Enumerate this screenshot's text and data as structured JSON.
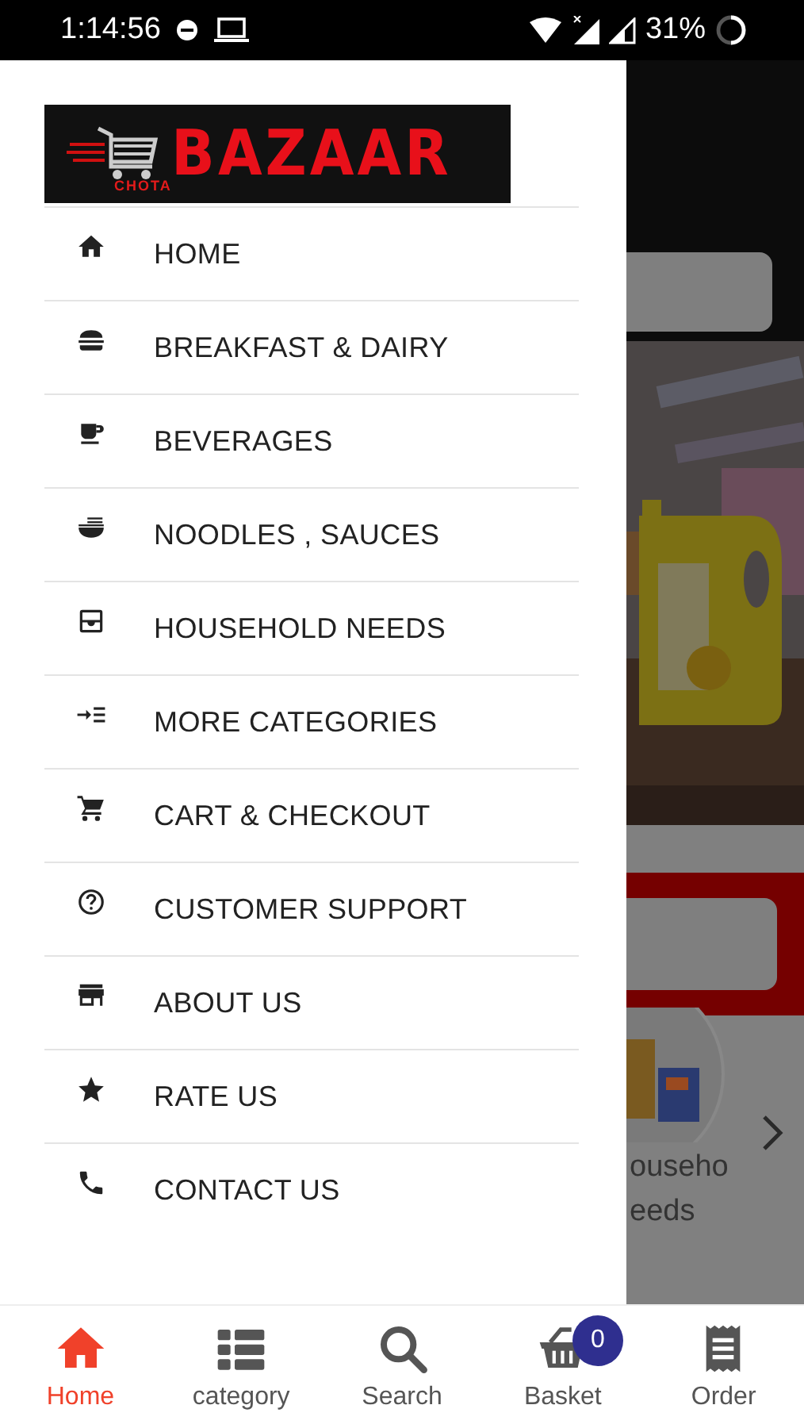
{
  "status_bar": {
    "time": "1:14:56",
    "battery": "31%"
  },
  "drawer": {
    "logo": {
      "small": "CHOTA",
      "big": "BAZAAR"
    },
    "items": [
      {
        "kind": "home",
        "label": "HOME"
      },
      {
        "kind": "burger",
        "label": "BREAKFAST & DAIRY"
      },
      {
        "kind": "cup",
        "label": "BEVERAGES"
      },
      {
        "kind": "bowl",
        "label": "NOODLES , SAUCES"
      },
      {
        "kind": "inbox",
        "label": "HOUSEHOLD NEEDS"
      },
      {
        "kind": "more",
        "label": "MORE CATEGORIES"
      },
      {
        "kind": "cart",
        "label": "CART & CHECKOUT"
      },
      {
        "kind": "help",
        "label": "CUSTOMER SUPPORT"
      },
      {
        "kind": "store",
        "label": "ABOUT US"
      },
      {
        "kind": "star",
        "label": "RATE US"
      },
      {
        "kind": "phone",
        "label": "CONTACT US"
      }
    ]
  },
  "background_page": {
    "category_label": [
      "ouseho",
      "eeds"
    ]
  },
  "bottom_nav": [
    {
      "kind": "home",
      "label": "Home",
      "selected": true
    },
    {
      "kind": "list",
      "label": "category",
      "selected": false
    },
    {
      "kind": "search",
      "label": "Search",
      "selected": false
    },
    {
      "kind": "basket",
      "label": "Basket",
      "selected": false,
      "badge": "0"
    },
    {
      "kind": "order",
      "label": "Order",
      "selected": false
    }
  ]
}
